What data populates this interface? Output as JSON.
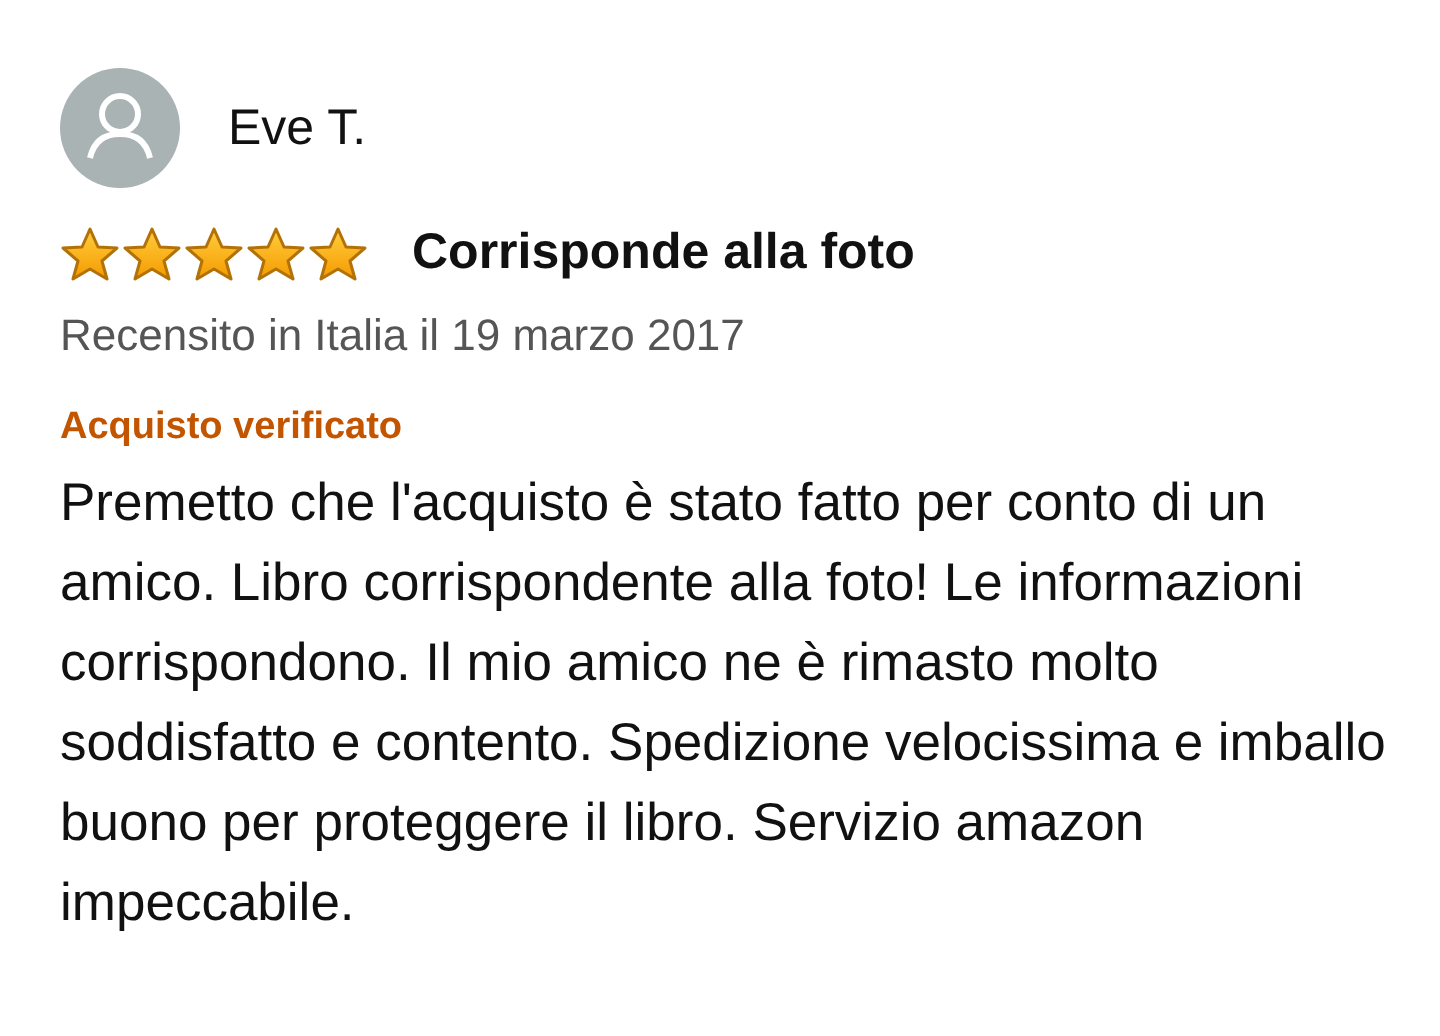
{
  "review": {
    "author": "Eve T.",
    "stars": 5,
    "title": "Corrisponde alla foto",
    "meta": "Recensito in Italia il 19 marzo 2017",
    "badge": "Acquisto verificato",
    "body": "Premetto che l'acquisto è stato fatto per conto di un amico. Libro corrispondente alla foto! Le informazioni corrispondono. Il mio amico ne è rimasto molto soddisfatto e contento. Spedizione velocissima e imballo buono per proteggere il libro. Servizio amazon impeccabile."
  }
}
